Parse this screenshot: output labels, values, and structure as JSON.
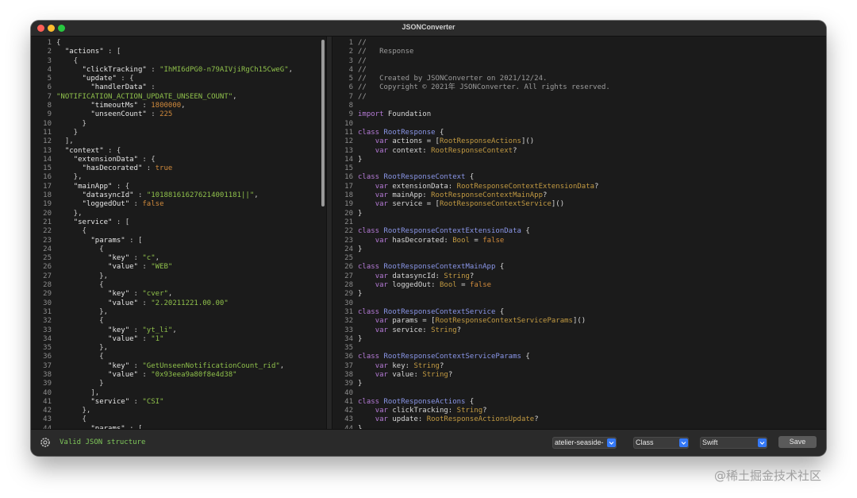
{
  "window": {
    "title": "JSONConverter"
  },
  "json_editor": {
    "lines": [
      [
        [
          "p",
          "{"
        ]
      ],
      [
        [
          "p",
          "  "
        ],
        [
          "k",
          "\"actions\""
        ],
        [
          "p",
          " : ["
        ]
      ],
      [
        [
          "p",
          "    {"
        ]
      ],
      [
        [
          "p",
          "      "
        ],
        [
          "k",
          "\"clickTracking\""
        ],
        [
          "p",
          " : "
        ],
        [
          "s",
          "\"IhMI6dPG0-n79AIVjiRgCh15CweG\""
        ],
        [
          "p",
          ","
        ]
      ],
      [
        [
          "p",
          "      "
        ],
        [
          "k",
          "\"update\""
        ],
        [
          "p",
          " : {"
        ]
      ],
      [
        [
          "p",
          "        "
        ],
        [
          "k",
          "\"handlerData\""
        ],
        [
          "p",
          " :"
        ]
      ],
      [
        [
          "s",
          "\"NOTIFICATION_ACTION_UPDATE_UNSEEN_COUNT\""
        ],
        [
          "p",
          ","
        ]
      ],
      [
        [
          "p",
          "        "
        ],
        [
          "k",
          "\"timeoutMs\""
        ],
        [
          "p",
          " : "
        ],
        [
          "n",
          "1800000"
        ],
        [
          "p",
          ","
        ]
      ],
      [
        [
          "p",
          "        "
        ],
        [
          "k",
          "\"unseenCount\""
        ],
        [
          "p",
          " : "
        ],
        [
          "n",
          "225"
        ]
      ],
      [
        [
          "p",
          "      }"
        ]
      ],
      [
        [
          "p",
          "    }"
        ]
      ],
      [
        [
          "p",
          "  ],"
        ]
      ],
      [
        [
          "p",
          "  "
        ],
        [
          "k",
          "\"context\""
        ],
        [
          "p",
          " : {"
        ]
      ],
      [
        [
          "p",
          "    "
        ],
        [
          "k",
          "\"extensionData\""
        ],
        [
          "p",
          " : {"
        ]
      ],
      [
        [
          "p",
          "      "
        ],
        [
          "k",
          "\"hasDecorated\""
        ],
        [
          "p",
          " : "
        ],
        [
          "n",
          "true"
        ]
      ],
      [
        [
          "p",
          "    },"
        ]
      ],
      [
        [
          "p",
          "    "
        ],
        [
          "k",
          "\"mainApp\""
        ],
        [
          "p",
          " : {"
        ]
      ],
      [
        [
          "p",
          "      "
        ],
        [
          "k",
          "\"datasyncId\""
        ],
        [
          "p",
          " : "
        ],
        [
          "s",
          "\"101881616276214001181||\""
        ],
        [
          "p",
          ","
        ]
      ],
      [
        [
          "p",
          "      "
        ],
        [
          "k",
          "\"loggedOut\""
        ],
        [
          "p",
          " : "
        ],
        [
          "n",
          "false"
        ]
      ],
      [
        [
          "p",
          "    },"
        ]
      ],
      [
        [
          "p",
          "    "
        ],
        [
          "k",
          "\"service\""
        ],
        [
          "p",
          " : ["
        ]
      ],
      [
        [
          "p",
          "      {"
        ]
      ],
      [
        [
          "p",
          "        "
        ],
        [
          "k",
          "\"params\""
        ],
        [
          "p",
          " : ["
        ]
      ],
      [
        [
          "p",
          "          {"
        ]
      ],
      [
        [
          "p",
          "            "
        ],
        [
          "k",
          "\"key\""
        ],
        [
          "p",
          " : "
        ],
        [
          "s",
          "\"c\""
        ],
        [
          "p",
          ","
        ]
      ],
      [
        [
          "p",
          "            "
        ],
        [
          "k",
          "\"value\""
        ],
        [
          "p",
          " : "
        ],
        [
          "s",
          "\"WEB\""
        ]
      ],
      [
        [
          "p",
          "          },"
        ]
      ],
      [
        [
          "p",
          "          {"
        ]
      ],
      [
        [
          "p",
          "            "
        ],
        [
          "k",
          "\"key\""
        ],
        [
          "p",
          " : "
        ],
        [
          "s",
          "\"cver\""
        ],
        [
          "p",
          ","
        ]
      ],
      [
        [
          "p",
          "            "
        ],
        [
          "k",
          "\"value\""
        ],
        [
          "p",
          " : "
        ],
        [
          "s",
          "\"2.20211221.00.00\""
        ]
      ],
      [
        [
          "p",
          "          },"
        ]
      ],
      [
        [
          "p",
          "          {"
        ]
      ],
      [
        [
          "p",
          "            "
        ],
        [
          "k",
          "\"key\""
        ],
        [
          "p",
          " : "
        ],
        [
          "s",
          "\"yt_li\""
        ],
        [
          "p",
          ","
        ]
      ],
      [
        [
          "p",
          "            "
        ],
        [
          "k",
          "\"value\""
        ],
        [
          "p",
          " : "
        ],
        [
          "s",
          "\"1\""
        ]
      ],
      [
        [
          "p",
          "          },"
        ]
      ],
      [
        [
          "p",
          "          {"
        ]
      ],
      [
        [
          "p",
          "            "
        ],
        [
          "k",
          "\"key\""
        ],
        [
          "p",
          " : "
        ],
        [
          "s",
          "\"GetUnseenNotificationCount_rid\""
        ],
        [
          "p",
          ","
        ]
      ],
      [
        [
          "p",
          "            "
        ],
        [
          "k",
          "\"value\""
        ],
        [
          "p",
          " : "
        ],
        [
          "s",
          "\"0x93eea9a80f8e4d38\""
        ]
      ],
      [
        [
          "p",
          "          }"
        ]
      ],
      [
        [
          "p",
          "        ],"
        ]
      ],
      [
        [
          "p",
          "        "
        ],
        [
          "k",
          "\"service\""
        ],
        [
          "p",
          " : "
        ],
        [
          "s",
          "\"CSI\""
        ]
      ],
      [
        [
          "p",
          "      },"
        ]
      ],
      [
        [
          "p",
          "      {"
        ]
      ],
      [
        [
          "p",
          "        "
        ],
        [
          "k",
          "\"params\""
        ],
        [
          "p",
          " : ["
        ]
      ]
    ]
  },
  "code_output": {
    "lines": [
      [
        [
          "cm",
          "//"
        ]
      ],
      [
        [
          "cm",
          "//   Response"
        ]
      ],
      [
        [
          "cm",
          "//"
        ]
      ],
      [
        [
          "cm",
          "//"
        ]
      ],
      [
        [
          "cm",
          "//   Created by JSONConverter on 2021/12/24."
        ]
      ],
      [
        [
          "cm",
          "//   Copyright © 2021年 JSONConverter. All rights reserved."
        ]
      ],
      [
        [
          "cm",
          "//"
        ]
      ],
      [
        [
          "tx",
          ""
        ]
      ],
      [
        [
          "kw",
          "import"
        ],
        [
          "tx",
          " Foundation"
        ]
      ],
      [
        [
          "tx",
          ""
        ]
      ],
      [
        [
          "kw",
          "class"
        ],
        [
          "tx",
          " "
        ],
        [
          "cls",
          "RootResponse"
        ],
        [
          "tx",
          " {"
        ]
      ],
      [
        [
          "tx",
          "    "
        ],
        [
          "kw",
          "var"
        ],
        [
          "tx",
          " actions = ["
        ],
        [
          "typ",
          "RootResponseActions"
        ],
        [
          "tx",
          "]()"
        ]
      ],
      [
        [
          "tx",
          "    "
        ],
        [
          "kw",
          "var"
        ],
        [
          "tx",
          " context: "
        ],
        [
          "typ",
          "RootResponseContext"
        ],
        [
          "tx",
          "?"
        ]
      ],
      [
        [
          "tx",
          "}"
        ]
      ],
      [
        [
          "tx",
          ""
        ]
      ],
      [
        [
          "kw",
          "class"
        ],
        [
          "tx",
          " "
        ],
        [
          "cls",
          "RootResponseContext"
        ],
        [
          "tx",
          " {"
        ]
      ],
      [
        [
          "tx",
          "    "
        ],
        [
          "kw",
          "var"
        ],
        [
          "tx",
          " extensionData: "
        ],
        [
          "typ",
          "RootResponseContextExtensionData"
        ],
        [
          "tx",
          "?"
        ]
      ],
      [
        [
          "tx",
          "    "
        ],
        [
          "kw",
          "var"
        ],
        [
          "tx",
          " mainApp: "
        ],
        [
          "typ",
          "RootResponseContextMainApp"
        ],
        [
          "tx",
          "?"
        ]
      ],
      [
        [
          "tx",
          "    "
        ],
        [
          "kw",
          "var"
        ],
        [
          "tx",
          " service = ["
        ],
        [
          "typ",
          "RootResponseContextService"
        ],
        [
          "tx",
          "]()"
        ]
      ],
      [
        [
          "tx",
          "}"
        ]
      ],
      [
        [
          "tx",
          ""
        ]
      ],
      [
        [
          "kw",
          "class"
        ],
        [
          "tx",
          " "
        ],
        [
          "cls",
          "RootResponseContextExtensionData"
        ],
        [
          "tx",
          " {"
        ]
      ],
      [
        [
          "tx",
          "    "
        ],
        [
          "kw",
          "var"
        ],
        [
          "tx",
          " hasDecorated: "
        ],
        [
          "typ",
          "Bool"
        ],
        [
          "tx",
          " = "
        ],
        [
          "n",
          "false"
        ]
      ],
      [
        [
          "tx",
          "}"
        ]
      ],
      [
        [
          "tx",
          ""
        ]
      ],
      [
        [
          "kw",
          "class"
        ],
        [
          "tx",
          " "
        ],
        [
          "cls",
          "RootResponseContextMainApp"
        ],
        [
          "tx",
          " {"
        ]
      ],
      [
        [
          "tx",
          "    "
        ],
        [
          "kw",
          "var"
        ],
        [
          "tx",
          " datasyncId: "
        ],
        [
          "typ",
          "String"
        ],
        [
          "tx",
          "?"
        ]
      ],
      [
        [
          "tx",
          "    "
        ],
        [
          "kw",
          "var"
        ],
        [
          "tx",
          " loggedOut: "
        ],
        [
          "typ",
          "Bool"
        ],
        [
          "tx",
          " = "
        ],
        [
          "n",
          "false"
        ]
      ],
      [
        [
          "tx",
          "}"
        ]
      ],
      [
        [
          "tx",
          ""
        ]
      ],
      [
        [
          "kw",
          "class"
        ],
        [
          "tx",
          " "
        ],
        [
          "cls",
          "RootResponseContextService"
        ],
        [
          "tx",
          " {"
        ]
      ],
      [
        [
          "tx",
          "    "
        ],
        [
          "kw",
          "var"
        ],
        [
          "tx",
          " params = ["
        ],
        [
          "typ",
          "RootResponseContextServiceParams"
        ],
        [
          "tx",
          "]()"
        ]
      ],
      [
        [
          "tx",
          "    "
        ],
        [
          "kw",
          "var"
        ],
        [
          "tx",
          " service: "
        ],
        [
          "typ",
          "String"
        ],
        [
          "tx",
          "?"
        ]
      ],
      [
        [
          "tx",
          "}"
        ]
      ],
      [
        [
          "tx",
          ""
        ]
      ],
      [
        [
          "kw",
          "class"
        ],
        [
          "tx",
          " "
        ],
        [
          "cls",
          "RootResponseContextServiceParams"
        ],
        [
          "tx",
          " {"
        ]
      ],
      [
        [
          "tx",
          "    "
        ],
        [
          "kw",
          "var"
        ],
        [
          "tx",
          " key: "
        ],
        [
          "typ",
          "String"
        ],
        [
          "tx",
          "?"
        ]
      ],
      [
        [
          "tx",
          "    "
        ],
        [
          "kw",
          "var"
        ],
        [
          "tx",
          " value: "
        ],
        [
          "typ",
          "String"
        ],
        [
          "tx",
          "?"
        ]
      ],
      [
        [
          "tx",
          "}"
        ]
      ],
      [
        [
          "tx",
          ""
        ]
      ],
      [
        [
          "kw",
          "class"
        ],
        [
          "tx",
          " "
        ],
        [
          "cls",
          "RootResponseActions"
        ],
        [
          "tx",
          " {"
        ]
      ],
      [
        [
          "tx",
          "    "
        ],
        [
          "kw",
          "var"
        ],
        [
          "tx",
          " clickTracking: "
        ],
        [
          "typ",
          "String"
        ],
        [
          "tx",
          "?"
        ]
      ],
      [
        [
          "tx",
          "    "
        ],
        [
          "kw",
          "var"
        ],
        [
          "tx",
          " update: "
        ],
        [
          "typ",
          "RootResponseActionsUpdate"
        ],
        [
          "tx",
          "?"
        ]
      ],
      [
        [
          "tx",
          "}"
        ]
      ]
    ]
  },
  "statusbar": {
    "settings_icon": "gear-icon",
    "status_text": "Valid JSON structure",
    "theme_select": "atelier-seaside-",
    "struct_select": "Class",
    "language_select": "Swift",
    "save_label": "Save"
  },
  "watermark": "@稀土掘金技术社区"
}
